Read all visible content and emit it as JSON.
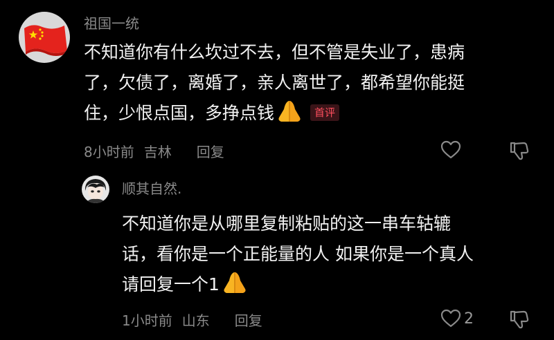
{
  "comments": [
    {
      "username": "祖国一统",
      "avatar_icon": "china-flag-avatar",
      "lines": [
        "不知道你有什么坎过不去，但不管是失业了，患病",
        "了，欠债了，离婚了，亲人离世了，都希望你能挺",
        "住，少恨点国，多挣点钱"
      ],
      "emoji": "praying-hands-emoji",
      "badge": "首评",
      "time": "8小时前",
      "location": "吉林",
      "reply_label": "回复",
      "like_count": ""
    },
    {
      "username": "顺其自然.",
      "avatar_icon": "anime-character-avatar",
      "lines": [
        "不知道你是从哪里复制粘贴的这一串车轱辘",
        "话，看你是一个正能量的人 如果你是一个真人",
        "请回复一个1"
      ],
      "emoji": "praying-hands-emoji",
      "time": "1小时前",
      "location": "山东",
      "reply_label": "回复",
      "like_count": "2"
    }
  ],
  "colors": {
    "background": "#000000",
    "text": "#f2f2f2",
    "muted": "#8a8a8a",
    "badge_text": "#ff4f5e",
    "badge_bg": "#3a1418"
  }
}
